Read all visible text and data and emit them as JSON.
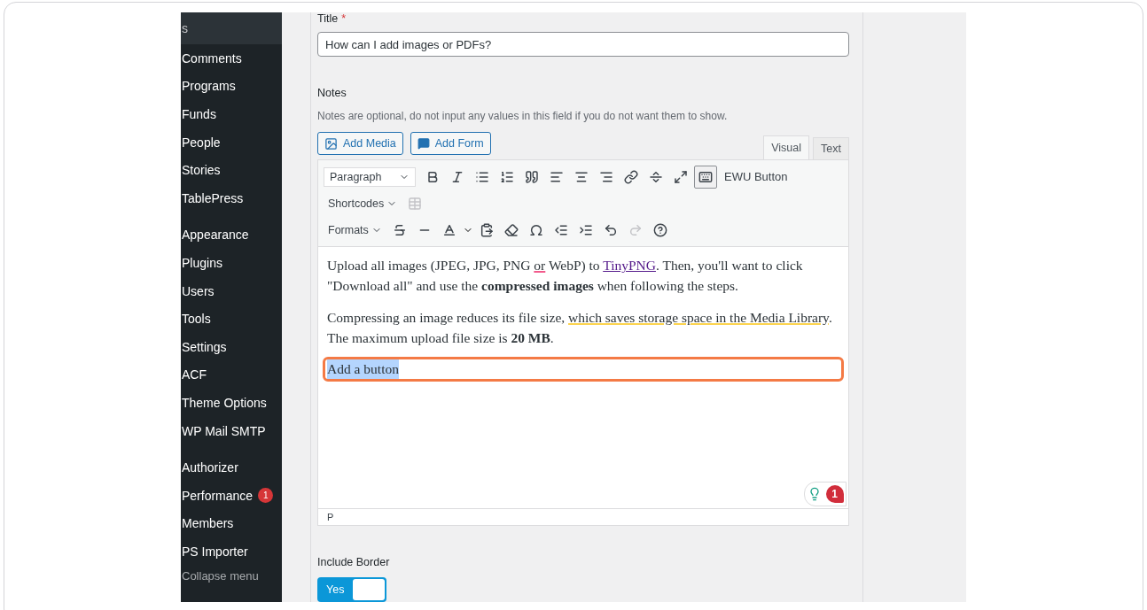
{
  "sidebar": {
    "groups": [
      [
        {
          "label": "s",
          "selected": true
        },
        {
          "label": "Comments",
          "selected": false
        },
        {
          "label": "Programs",
          "selected": false
        },
        {
          "label": "Funds",
          "selected": false
        },
        {
          "label": "People",
          "selected": false
        },
        {
          "label": "Stories",
          "selected": false
        },
        {
          "label": "TablePress",
          "selected": false
        }
      ],
      [
        {
          "label": "Appearance",
          "selected": false
        },
        {
          "label": "Plugins",
          "selected": false
        },
        {
          "label": "Users",
          "selected": false
        },
        {
          "label": "Tools",
          "selected": false
        },
        {
          "label": "Settings",
          "selected": false
        },
        {
          "label": "ACF",
          "selected": false
        },
        {
          "label": "Theme Options",
          "selected": false
        },
        {
          "label": "WP Mail SMTP",
          "selected": false
        }
      ],
      [
        {
          "label": "Authorizer",
          "selected": false
        },
        {
          "label": "Performance",
          "selected": false,
          "badge": "1"
        },
        {
          "label": "Members",
          "selected": false
        },
        {
          "label": "PS Importer",
          "selected": false
        }
      ]
    ],
    "collapse": "Collapse menu"
  },
  "title_field": {
    "label": "Title",
    "required": "*",
    "value": "How can I add images or PDFs?"
  },
  "notes": {
    "label": "Notes",
    "hint": "Notes are optional, do not input any values in this field if you do not want them to show."
  },
  "media_buttons": [
    {
      "label": "Add Media",
      "kind": "media"
    },
    {
      "label": "Add Form",
      "kind": "form"
    }
  ],
  "editor_tabs": [
    {
      "label": "Visual",
      "selected": true
    },
    {
      "label": "Text",
      "selected": false
    }
  ],
  "toolbar": {
    "format": "Paragraph",
    "custom_button": "EWU Button",
    "shortcodes": "Shortcodes",
    "formats": "Formats"
  },
  "content": [
    [
      {
        "kind": "text",
        "text": "Upload all images (JPEG, JPG, PNG "
      },
      {
        "kind": "spelling",
        "text": "or"
      },
      {
        "kind": "text",
        "text": " WebP) to "
      },
      {
        "kind": "link",
        "text": "TinyPNG"
      },
      {
        "kind": "text",
        "text": ". Then, you'll want to click \"Download all\" and use the "
      },
      {
        "kind": "bold",
        "text": "compressed images"
      },
      {
        "kind": "text",
        "text": " when following the steps."
      }
    ],
    [
      {
        "kind": "text",
        "text": "Compressing an image reduces its file size, "
      },
      {
        "kind": "grammar",
        "text": "which saves storage space in the Media Library"
      },
      {
        "kind": "text",
        "text": ". The maximum upload file size is "
      },
      {
        "kind": "bold",
        "text": "20 MB"
      },
      {
        "kind": "text",
        "text": "."
      }
    ]
  ],
  "selected_block": {
    "text": "Add a button",
    "highlighted": true
  },
  "grammar_badge": "1",
  "status_path": "P",
  "include_border": {
    "label": "Include Border",
    "toggle": {
      "label": "Yes",
      "on": true
    }
  }
}
